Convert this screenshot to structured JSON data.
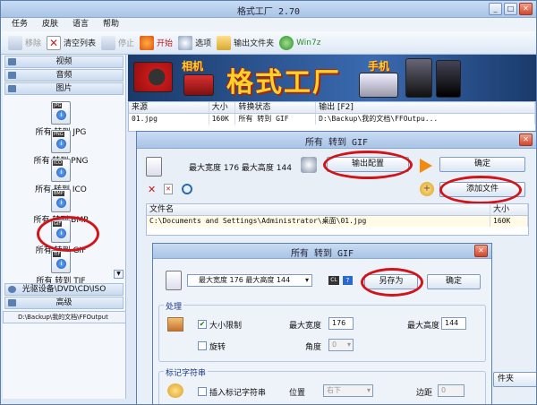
{
  "app_title": "格式工厂 2.70",
  "menu": [
    "任务",
    "皮肤",
    "语言",
    "帮助"
  ],
  "toolbar": {
    "remove": "移除",
    "clear": "清空列表",
    "stop": "停止",
    "start": "开始",
    "options": "选项",
    "output_folder": "输出文件夹",
    "win7z": "Win7z"
  },
  "sidebar": {
    "cat_video": "视频",
    "cat_audio": "音频",
    "cat_image": "图片",
    "formats": [
      "所有 转到 JPG",
      "所有 转到 PNG",
      "所有 转到 ICO",
      "所有 转到 BMP",
      "所有 转到 GIF",
      "所有 转到 TIF"
    ],
    "format_badges": [
      "JPG",
      "PNG",
      "ICO",
      "BMP",
      "GIF",
      "TIF"
    ],
    "cat_rom": "光驱设备\\DVD\\CD\\ISO",
    "cat_advanced": "高级"
  },
  "banner": {
    "camera_label": "相机",
    "title": "格式工厂",
    "phone_label": "手机"
  },
  "filelist": {
    "headers": [
      "来源",
      "大小",
      "转换状态",
      "输出 [F2]"
    ],
    "row": {
      "source": "01.jpg",
      "size": "160K",
      "status": "所有 转到 GIF",
      "output": "D:\\Backup\\我的文档\\FFOutpu..."
    }
  },
  "status_path": "D:\\Backup\\我的文档\\FFOutput",
  "dialog1": {
    "title": "所有 转到 GIF",
    "info": "最大宽度 176 最大高度 144",
    "output_config": "输出配置",
    "ok": "确定",
    "add_file": "添加文件",
    "list_headers": [
      "文件名",
      "大小"
    ],
    "row": {
      "name": "C:\\Documents and Settings\\Administrator\\桌面\\01.jpg",
      "size": "160K"
    },
    "partial_btn": "件夹"
  },
  "dialog2": {
    "title": "所有 转到 GIF",
    "preset": "最大宽度 176 最大高度 144",
    "save_as": "另存为",
    "ok": "确定",
    "group_process": "处理",
    "size_limit": "大小限制",
    "max_width_label": "最大宽度",
    "max_width": "176",
    "max_height_label": "最大高度",
    "max_height": "144",
    "rotate": "旋转",
    "angle_label": "角度",
    "angle": "0",
    "group_watermark": "标记字符串",
    "insert_watermark": "插入标记字符串",
    "position_label": "位置",
    "position": "右下",
    "margin_label": "边距",
    "margin": "0"
  },
  "colors": {
    "accent": "#d0141a",
    "title": "#ffd02a"
  }
}
